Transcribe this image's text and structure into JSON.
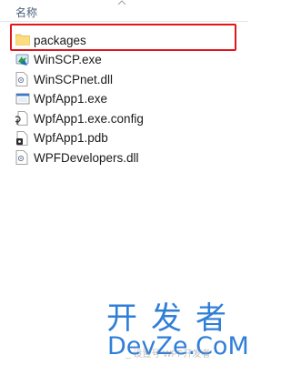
{
  "column_header": {
    "name_label": "名称",
    "sort_icon": "chevron-up-icon"
  },
  "files": [
    {
      "name": "packages",
      "icon": "folder-icon",
      "selected": true
    },
    {
      "name": "WinSCP.exe",
      "icon": "winscp-exe-icon"
    },
    {
      "name": "WinSCPnet.dll",
      "icon": "dll-file-icon"
    },
    {
      "name": "WpfApp1.exe",
      "icon": "app-exe-icon"
    },
    {
      "name": "WpfApp1.exe.config",
      "icon": "config-file-icon"
    },
    {
      "name": "WpfApp1.pdb",
      "icon": "pdb-file-icon"
    },
    {
      "name": "WPFDevelopers.dll",
      "icon": "dll-file-icon"
    }
  ],
  "colors": {
    "highlight": "#e0171b",
    "watermark": "#2f7ed8"
  },
  "watermark": {
    "cn_text": "开发者",
    "en_text": "DevZe.CoM",
    "overlay_text": "_ 设置号 WPF开发者"
  }
}
